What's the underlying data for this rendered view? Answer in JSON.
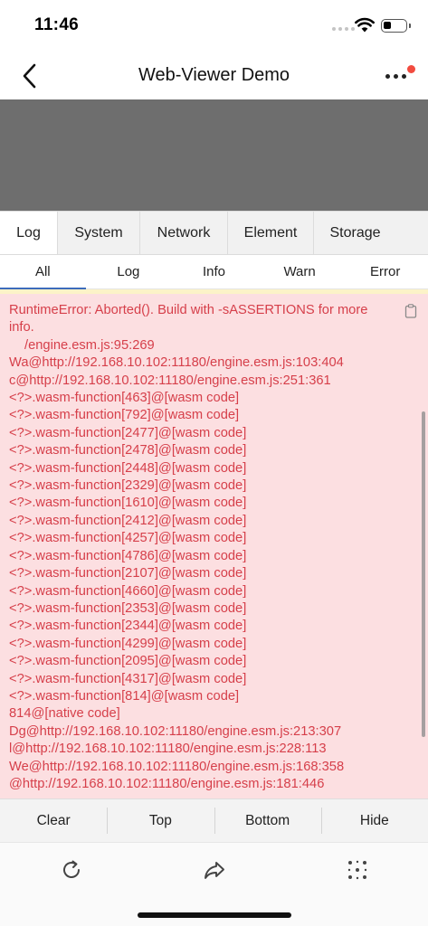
{
  "status_bar": {
    "time": "11:46",
    "battery_level": 0.35
  },
  "nav": {
    "title": "Web-Viewer Demo",
    "badge_color": "#f24b3f"
  },
  "main_tabs": [
    {
      "label": "Log",
      "active": true
    },
    {
      "label": "System",
      "active": false
    },
    {
      "label": "Network",
      "active": false
    },
    {
      "label": "Element",
      "active": false
    },
    {
      "label": "Storage",
      "active": false
    }
  ],
  "sub_tabs": [
    {
      "label": "All",
      "active": true
    },
    {
      "label": "Log",
      "active": false
    },
    {
      "label": "Info",
      "active": false
    },
    {
      "label": "Warn",
      "active": false
    },
    {
      "label": "Error",
      "active": false
    }
  ],
  "log": {
    "text_color": "#d63f4a",
    "background": "#fcdfe1",
    "header": "RuntimeError: Aborted(). Build with -sASSERTIONS for more info.",
    "first_frame": "/engine.esm.js:95:269",
    "lines": [
      "Wa@http://192.168.10.102:11180/engine.esm.js:103:404",
      "c@http://192.168.10.102:11180/engine.esm.js:251:361",
      "<?>.wasm-function[463]@[wasm code]",
      "<?>.wasm-function[792]@[wasm code]",
      "<?>.wasm-function[2477]@[wasm code]",
      "<?>.wasm-function[2478]@[wasm code]",
      "<?>.wasm-function[2448]@[wasm code]",
      "<?>.wasm-function[2329]@[wasm code]",
      "<?>.wasm-function[1610]@[wasm code]",
      "<?>.wasm-function[2412]@[wasm code]",
      "<?>.wasm-function[4257]@[wasm code]",
      "<?>.wasm-function[4786]@[wasm code]",
      "<?>.wasm-function[2107]@[wasm code]",
      "<?>.wasm-function[4660]@[wasm code]",
      "<?>.wasm-function[2353]@[wasm code]",
      "<?>.wasm-function[2344]@[wasm code]",
      "<?>.wasm-function[4299]@[wasm code]",
      "<?>.wasm-function[2095]@[wasm code]",
      "<?>.wasm-function[4317]@[wasm code]",
      "<?>.wasm-function[814]@[wasm code]",
      "814@[native code]",
      "Dg@http://192.168.10.102:11180/engine.esm.js:213:307",
      "l@http://192.168.10.102:11180/engine.esm.js:228:113",
      "We@http://192.168.10.102:11180/engine.esm.js:168:358",
      "@http://192.168.10.102:11180/engine.esm.js:181:446"
    ]
  },
  "toolbar": {
    "clear": "Clear",
    "top": "Top",
    "bottom": "Bottom",
    "hide": "Hide"
  },
  "browser_bar": {
    "icons": [
      "refresh-icon",
      "share-icon",
      "grid-icon"
    ]
  }
}
